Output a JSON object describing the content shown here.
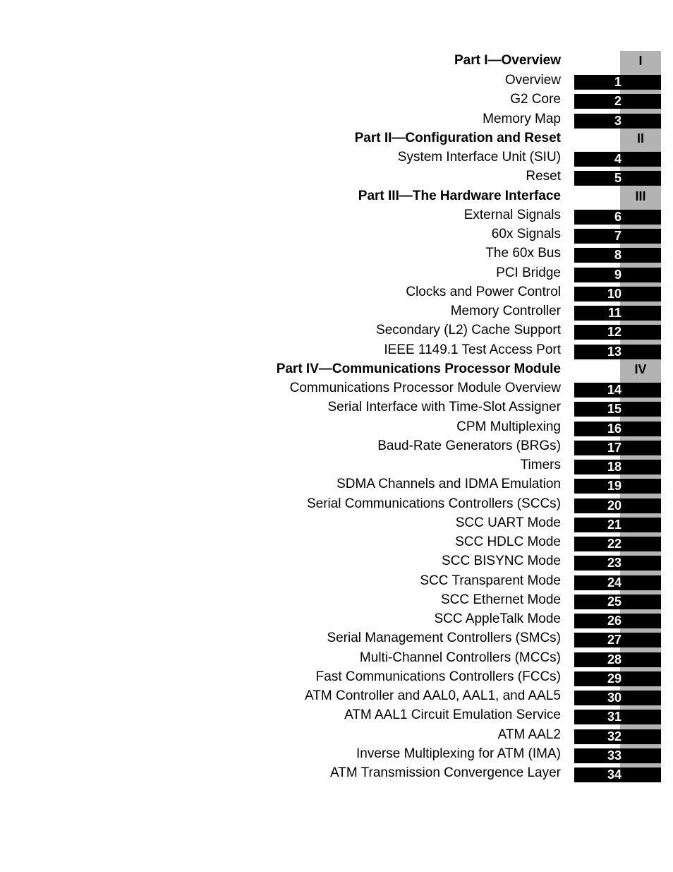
{
  "colors": {
    "part_tab_gray": "#b3b3b3",
    "chapter_bar": "#000000",
    "chapter_number_text": "#ffffff"
  },
  "toc": [
    {
      "type": "part",
      "title": "Part I—Overview",
      "tab": "I"
    },
    {
      "type": "chapter",
      "title": "Overview",
      "number": "1"
    },
    {
      "type": "chapter",
      "title": "G2 Core",
      "number": "2"
    },
    {
      "type": "chapter",
      "title": "Memory Map",
      "number": "3"
    },
    {
      "type": "part",
      "title": "Part II—Configuration and Reset",
      "tab": "II"
    },
    {
      "type": "chapter",
      "title": "System Interface Unit (SIU)",
      "number": "4"
    },
    {
      "type": "chapter",
      "title": "Reset",
      "number": "5"
    },
    {
      "type": "part",
      "title": "Part III—The Hardware Interface",
      "tab": "III"
    },
    {
      "type": "chapter",
      "title": "External Signals",
      "number": "6"
    },
    {
      "type": "chapter",
      "title": "60x Signals",
      "number": "7"
    },
    {
      "type": "chapter",
      "title": "The 60x Bus",
      "number": "8"
    },
    {
      "type": "chapter",
      "title": "PCI Bridge",
      "number": "9"
    },
    {
      "type": "chapter",
      "title": "Clocks and Power Control",
      "number": "10"
    },
    {
      "type": "chapter",
      "title": "Memory Controller",
      "number": "11"
    },
    {
      "type": "chapter",
      "title": "Secondary (L2) Cache Support",
      "number": "12"
    },
    {
      "type": "chapter",
      "title": "IEEE 1149.1 Test Access Port",
      "number": "13"
    },
    {
      "type": "part",
      "title": "Part IV—Communications Processor Module",
      "tab": "IV"
    },
    {
      "type": "chapter",
      "title": "Communications Processor Module Overview",
      "number": "14"
    },
    {
      "type": "chapter",
      "title": "Serial Interface with Time-Slot Assigner",
      "number": "15"
    },
    {
      "type": "chapter",
      "title": "CPM Multiplexing",
      "number": "16"
    },
    {
      "type": "chapter",
      "title": "Baud-Rate Generators (BRGs)",
      "number": "17"
    },
    {
      "type": "chapter",
      "title": "Timers",
      "number": "18"
    },
    {
      "type": "chapter",
      "title": "SDMA Channels and IDMA Emulation",
      "number": "19"
    },
    {
      "type": "chapter",
      "title": "Serial Communications Controllers (SCCs)",
      "number": "20"
    },
    {
      "type": "chapter",
      "title": "SCC UART Mode",
      "number": "21"
    },
    {
      "type": "chapter",
      "title": "SCC HDLC Mode",
      "number": "22"
    },
    {
      "type": "chapter",
      "title": "SCC BISYNC Mode",
      "number": "23"
    },
    {
      "type": "chapter",
      "title": "SCC Transparent Mode",
      "number": "24"
    },
    {
      "type": "chapter",
      "title": "SCC Ethernet Mode",
      "number": "25"
    },
    {
      "type": "chapter",
      "title": "SCC AppleTalk Mode",
      "number": "26"
    },
    {
      "type": "chapter",
      "title": "Serial Management Controllers (SMCs)",
      "number": "27"
    },
    {
      "type": "chapter",
      "title": "Multi-Channel Controllers (MCCs)",
      "number": "28"
    },
    {
      "type": "chapter",
      "title": "Fast Communications Controllers (FCCs)",
      "number": "29"
    },
    {
      "type": "chapter",
      "title": "ATM Controller and AAL0, AAL1, and AAL5",
      "number": "30"
    },
    {
      "type": "chapter",
      "title": "ATM AAL1 Circuit Emulation Service",
      "number": "31"
    },
    {
      "type": "chapter",
      "title": "ATM AAL2",
      "number": "32"
    },
    {
      "type": "chapter",
      "title": "Inverse Multiplexing for ATM (IMA)",
      "number": "33"
    },
    {
      "type": "chapter",
      "title": "ATM Transmission Convergence Layer",
      "number": "34"
    }
  ]
}
